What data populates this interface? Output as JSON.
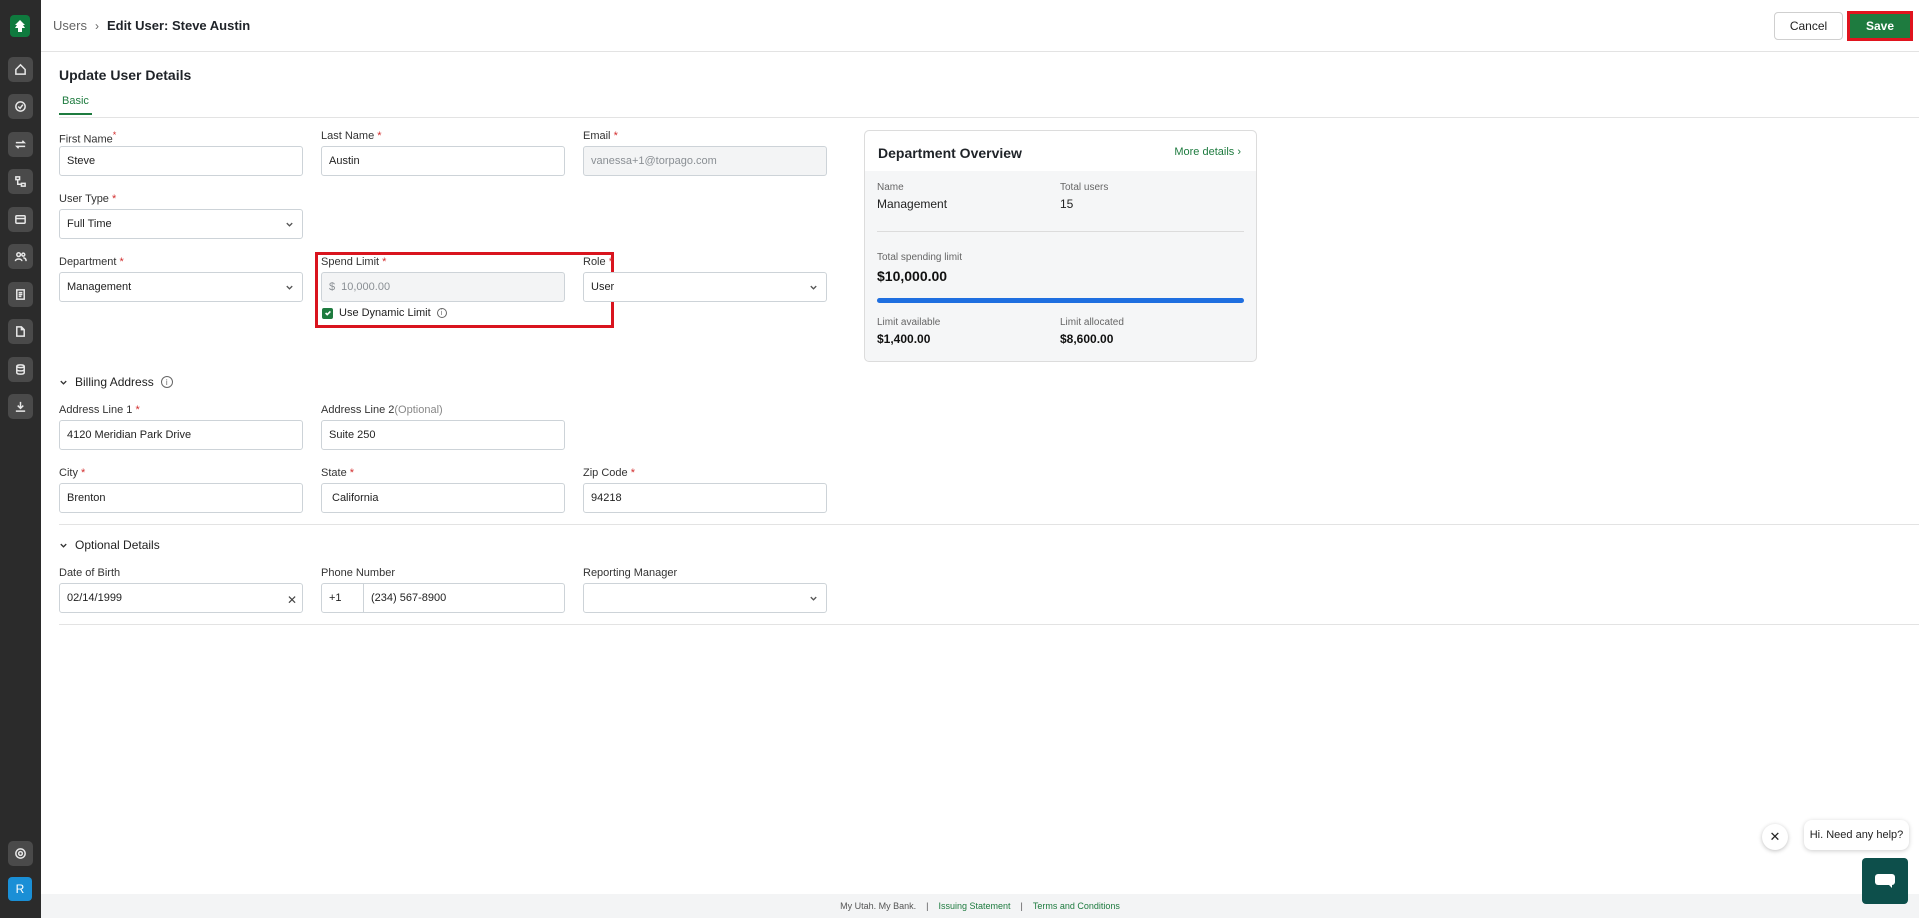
{
  "breadcrumb": {
    "parent": "Users",
    "current": "Edit User: Steve Austin"
  },
  "actions": {
    "cancel": "Cancel",
    "save": "Save"
  },
  "page": {
    "title": "Update User Details",
    "tab": "Basic"
  },
  "sidebar": {
    "icons": [
      "home-icon",
      "check-circle-icon",
      "transfer-icon",
      "workflow-icon",
      "card-icon",
      "users-icon",
      "ledger-icon",
      "document-icon",
      "database-icon",
      "download-icon"
    ],
    "bottom_icon": "settings-icon",
    "avatar": "R"
  },
  "fields": {
    "first_name": {
      "label": "First Name",
      "value": "Steve"
    },
    "last_name": {
      "label": "Last Name",
      "value": "Austin"
    },
    "email": {
      "label": "Email",
      "value": "vanessa+1@torpago.com"
    },
    "user_type": {
      "label": "User Type",
      "value": "Full Time"
    },
    "department": {
      "label": "Department",
      "value": "Management"
    },
    "spend_limit": {
      "label": "Spend Limit",
      "currency": "$",
      "value": "10,000.00"
    },
    "dynamic_limit": {
      "label": "Use Dynamic Limit",
      "checked": true
    },
    "role": {
      "label": "Role",
      "value": "User"
    }
  },
  "overview": {
    "title": "Department Overview",
    "more": "More details",
    "name_label": "Name",
    "name_value": "Management",
    "users_label": "Total users",
    "users_value": "15",
    "total_label": "Total spending limit",
    "total_value": "$10,000.00",
    "available_label": "Limit available",
    "available_value": "$1,400.00",
    "allocated_label": "Limit allocated",
    "allocated_value": "$8,600.00",
    "bar_fill_percent": 100,
    "bar_color": "#1f6fe0"
  },
  "billing": {
    "title": "Billing Address",
    "address1": {
      "label": "Address Line 1",
      "value": "4120 Meridian Park Drive"
    },
    "address2": {
      "label": "Address Line 2",
      "optional": "(Optional)",
      "value": "Suite 250"
    },
    "city": {
      "label": "City",
      "value": "Brenton"
    },
    "state": {
      "label": "State",
      "value": "California"
    },
    "zip": {
      "label": "Zip Code",
      "value": "94218"
    }
  },
  "optional": {
    "title": "Optional Details",
    "dob": {
      "label": "Date of Birth",
      "value": "02/14/1999"
    },
    "phone": {
      "label": "Phone Number",
      "code": "+1",
      "value": "(234) 567-8900"
    },
    "manager": {
      "label": "Reporting Manager",
      "value": ""
    }
  },
  "footer": {
    "tagline": "My Utah. My Bank.",
    "link1": "Issuing Statement",
    "link2": "Terms and Conditions"
  },
  "help": {
    "text": "Hi. Need any help?"
  },
  "colors": {
    "brand": "#1e7b3f",
    "highlight": "#d9141e",
    "required": "#d32f2f"
  }
}
